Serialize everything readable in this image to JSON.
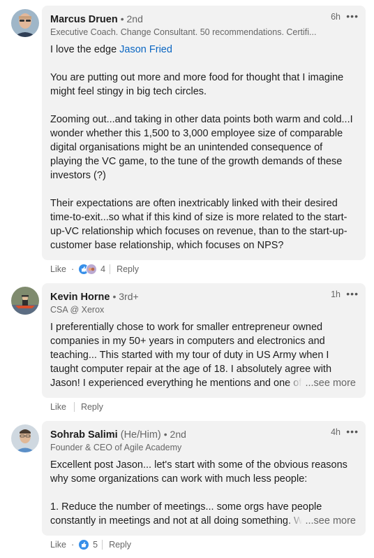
{
  "comments": [
    {
      "name": "Marcus Druen",
      "pronouns": "",
      "degree": "• 2nd",
      "headline": "Executive Coach. Change Consultant. 50 recommendations. Certifi...",
      "time": "6h",
      "more": "•••",
      "intro": "I love the edge ",
      "mention": "Jason Fried",
      "paragraphs": [
        "You are putting out more and more food for thought that I imagine might feel stingy in big tech circles.",
        "Zooming out...and taking in other data points both warm and cold...I wonder whether this 1,500 to 3,000 employee size of comparable digital organisations might be an unintended consequence of playing the VC game, to the tune of the growth demands of these investors (?)",
        "Their expectations are often inextricably linked with their desired time-to-exit...so what if this kind of size is more related to the start-up-VC relationship which focuses on revenue, than to the start-up-customer base relationship, which focuses on NPS?"
      ],
      "like_label": "Like",
      "dot": "·",
      "reaction_count": "4",
      "reply_label": "Reply"
    },
    {
      "name": "Kevin Horne",
      "pronouns": "",
      "degree": "• 3rd+",
      "headline": "CSA @ Xerox",
      "time": "1h",
      "more": "•••",
      "lines": [
        "I preferentially chose to work for smaller entrepreneur owned",
        "companies in my 50+ years in computers and electronics and",
        "teaching... This started with my tour of duty in US Army when I",
        "taught computer repair at the age of 18. I absolutely agree with",
        "Jason! I experienced everything he mentions and one of"
      ],
      "see_more": "...see more",
      "like_label": "Like",
      "dot": "·",
      "reply_label": "Reply"
    },
    {
      "name": "Sohrab Salimi",
      "pronouns": "(He/Him)",
      "degree": "• 2nd",
      "headline": "Founder & CEO of Agile Academy",
      "time": "4h",
      "more": "•••",
      "lines": [
        "Excellent post Jason... let's start with some of the obvious reasons",
        "why some organizations can work with much less people:",
        "",
        "1. Reduce the number of meetings... some orgs have people",
        "constantly in meetings and not at all doing something. We"
      ],
      "see_more": "...see more",
      "like_label": "Like",
      "dot": "·",
      "reaction_count": "5",
      "reply_label": "Reply"
    }
  ],
  "colors": {
    "bubble": "#f2f2f2",
    "mention": "#0a66c2",
    "like_reaction": "#378fe9"
  }
}
